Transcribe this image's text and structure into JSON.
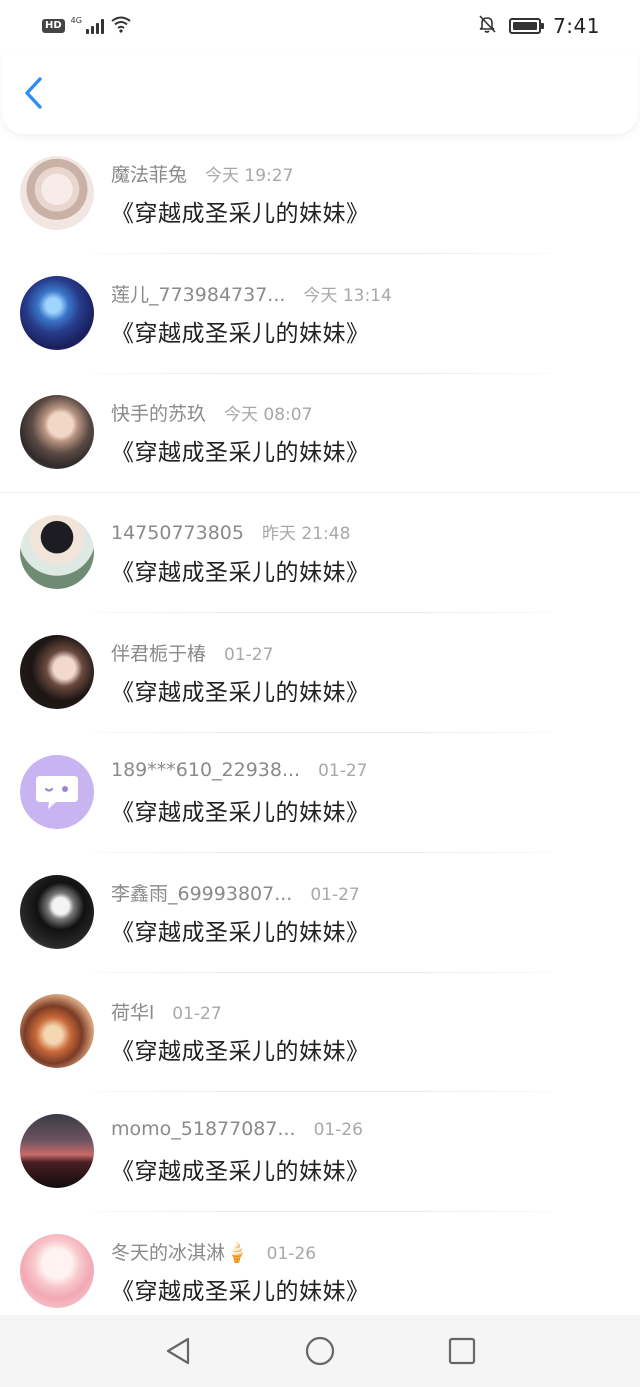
{
  "status_bar": {
    "hd_badge": "HD",
    "network": "4G",
    "time": "7:41",
    "icons": [
      "hd-icon",
      "signal-icon",
      "wifi-icon",
      "bell-off-icon",
      "battery-charging-icon"
    ]
  },
  "header": {
    "back_icon": "chevron-left-icon",
    "accent_color": "#2f8ef4"
  },
  "list": {
    "items": [
      {
        "username": "魔法菲兔",
        "timestamp": "今天 19:27",
        "message": "《穿越成圣采儿的妹妹》"
      },
      {
        "username": "莲儿_773984737...",
        "timestamp": "今天 13:14",
        "message": "《穿越成圣采儿的妹妹》"
      },
      {
        "username": "快手的苏玖",
        "timestamp": "今天 08:07",
        "message": "《穿越成圣采儿的妹妹》"
      },
      {
        "username": "14750773805",
        "timestamp": "昨天 21:48",
        "message": "《穿越成圣采儿的妹妹》"
      },
      {
        "username": "伴君栀于椿",
        "timestamp": "01-27",
        "message": "《穿越成圣采儿的妹妹》"
      },
      {
        "username": "189***610_22938...",
        "timestamp": "01-27",
        "message": "《穿越成圣采儿的妹妹》"
      },
      {
        "username": "李鑫雨_69993807...",
        "timestamp": "01-27",
        "message": "《穿越成圣采儿的妹妹》"
      },
      {
        "username": "荷华l",
        "timestamp": "01-27",
        "message": "《穿越成圣采儿的妹妹》"
      },
      {
        "username": "momo_51877087...",
        "timestamp": "01-26",
        "message": "《穿越成圣采儿的妹妹》"
      },
      {
        "username": "冬天的冰淇淋🍦",
        "timestamp": "01-26",
        "message": "《穿越成圣采儿的妹妹》"
      }
    ]
  },
  "nav_bar": {
    "icons": [
      "back-triangle-icon",
      "home-circle-icon",
      "recents-square-icon"
    ]
  }
}
